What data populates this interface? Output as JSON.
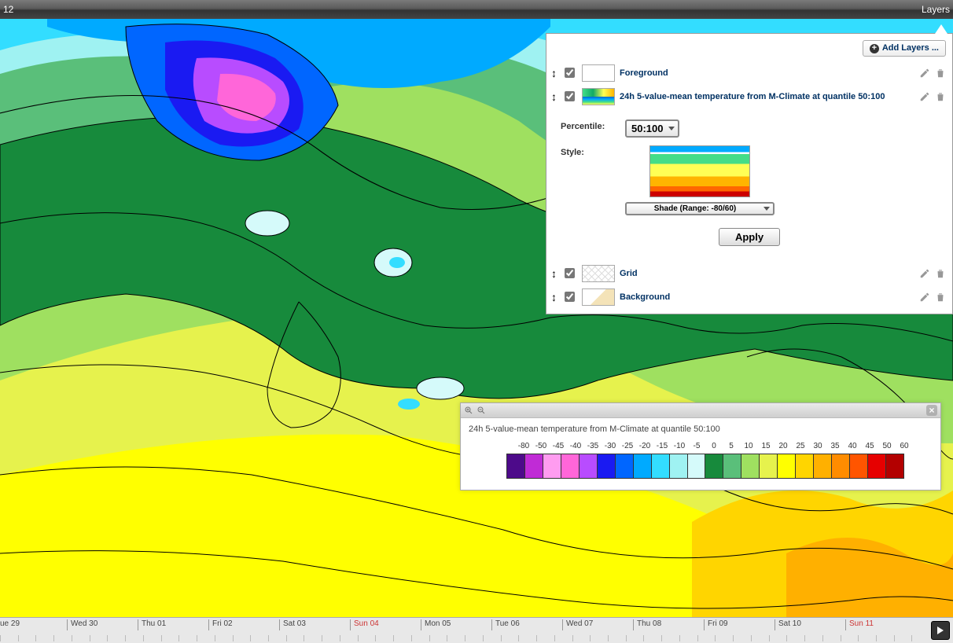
{
  "top_bar": {
    "left": "12",
    "right": "Layers"
  },
  "add_layers_label": "Add Layers ...",
  "layers": [
    {
      "title": "Foreground",
      "thumb": "fg"
    },
    {
      "title": "24h 5-value-mean temperature from M-Climate at quantile 50:100",
      "thumb": "climate"
    },
    {
      "title": "Grid",
      "thumb": "grid"
    },
    {
      "title": "Background",
      "thumb": "bg"
    }
  ],
  "settings": {
    "percentile_label": "Percentile:",
    "percentile_value": "50:100",
    "style_label": "Style:",
    "shade_value": "Shade (Range: -80/60)",
    "apply_label": "Apply"
  },
  "legend": {
    "title": "24h 5-value-mean temperature from M-Climate at quantile 50:100",
    "scale": [
      {
        "lbl": "-80",
        "c": "#4d0a8a"
      },
      {
        "lbl": "-50",
        "c": "#c02bd6"
      },
      {
        "lbl": "-45",
        "c": "#ff9cf0"
      },
      {
        "lbl": "-40",
        "c": "#ff66d9"
      },
      {
        "lbl": "-35",
        "c": "#b84cff"
      },
      {
        "lbl": "-30",
        "c": "#1a1af2"
      },
      {
        "lbl": "-25",
        "c": "#0066ff"
      },
      {
        "lbl": "-20",
        "c": "#00aaff"
      },
      {
        "lbl": "-15",
        "c": "#33ddff"
      },
      {
        "lbl": "-10",
        "c": "#9ff2f2"
      },
      {
        "lbl": "-5",
        "c": "#d5fafa"
      },
      {
        "lbl": "0",
        "c": "#178a3c"
      },
      {
        "lbl": "5",
        "c": "#5abf7a"
      },
      {
        "lbl": "10",
        "c": "#9fe060"
      },
      {
        "lbl": "15",
        "c": "#e6f24d"
      },
      {
        "lbl": "20",
        "c": "#ffff00"
      },
      {
        "lbl": "25",
        "c": "#ffd500"
      },
      {
        "lbl": "30",
        "c": "#ffb000"
      },
      {
        "lbl": "35",
        "c": "#ff8c00"
      },
      {
        "lbl": "40",
        "c": "#ff5500"
      },
      {
        "lbl": "45",
        "c": "#e60000"
      },
      {
        "lbl": "50",
        "c": "#b30000"
      },
      {
        "lbl": "60",
        "c": ""
      }
    ]
  },
  "timeline": [
    {
      "lbl": "ue 29",
      "red": false
    },
    {
      "lbl": "Wed 30",
      "red": false
    },
    {
      "lbl": "Thu 01",
      "red": false
    },
    {
      "lbl": "Fri 02",
      "red": false
    },
    {
      "lbl": "Sat 03",
      "red": false
    },
    {
      "lbl": "Sun 04",
      "red": true
    },
    {
      "lbl": "Mon 05",
      "red": false
    },
    {
      "lbl": "Tue 06",
      "red": false
    },
    {
      "lbl": "Wed 07",
      "red": false
    },
    {
      "lbl": "Thu 08",
      "red": false
    },
    {
      "lbl": "Fri 09",
      "red": false
    },
    {
      "lbl": "Sat 10",
      "red": false
    },
    {
      "lbl": "Sun 11",
      "red": true
    }
  ]
}
